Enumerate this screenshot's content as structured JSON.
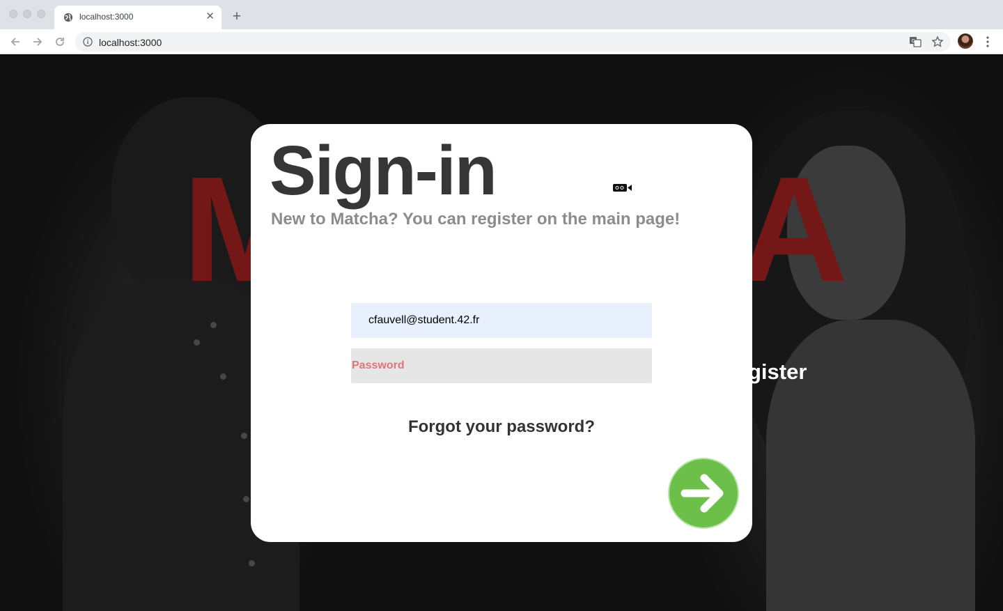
{
  "browser": {
    "tab_title": "localhost:3000",
    "url": "localhost:3000",
    "icons": {
      "favicon": "globe-icon",
      "close": "close-icon",
      "new_tab": "plus-icon",
      "back": "back-arrow-icon",
      "forward": "forward-arrow-icon",
      "reload": "reload-icon",
      "site_info": "info-icon",
      "translate": "translate-icon",
      "bookmark": "star-icon",
      "profile": "avatar",
      "menu": "more-vert-icon"
    }
  },
  "background": {
    "brand_letters_left": "M",
    "brand_letters_right": "A",
    "register_text_partial": "gister",
    "brand_color": "#741717"
  },
  "modal": {
    "title": "Sign-in",
    "subtitle": "New to Matcha? You can register on the main page!",
    "email_value": "cfauvell@student.42.fr",
    "password_placeholder": "Password",
    "forgot_link": "Forgot your password?",
    "submit_icon": "arrow-right-icon",
    "submit_color": "#6cc04a",
    "camera_icon": "video-camera-icon"
  }
}
